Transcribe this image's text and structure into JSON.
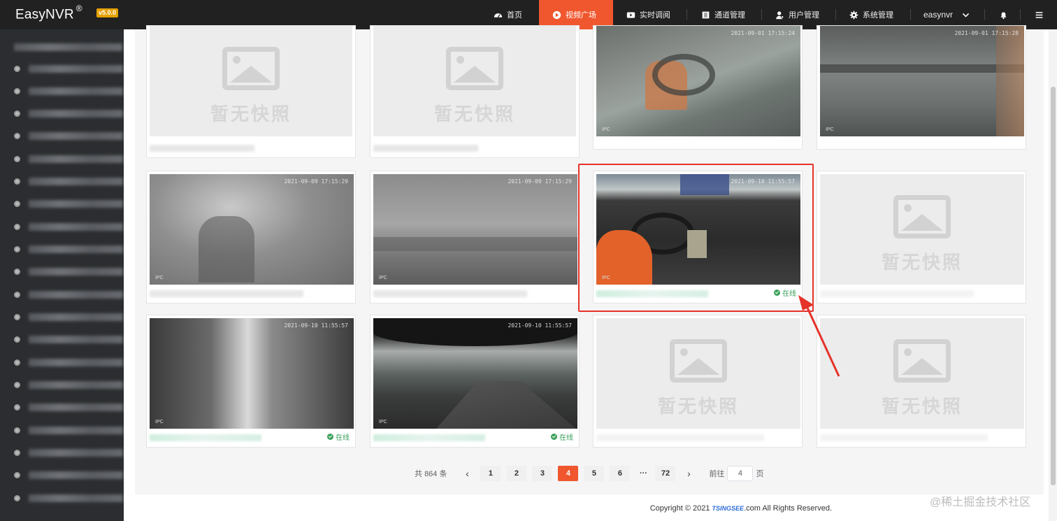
{
  "app": {
    "name": "EasyNVR",
    "trademark": "®",
    "version": "v5.0.0"
  },
  "nav": {
    "home": "首页",
    "plaza": "视频广场",
    "live": "实时调阅",
    "channel": "通道管理",
    "user": "用户管理",
    "system": "系统管理",
    "account": "easynvr"
  },
  "grid": {
    "placeholder_text": "暂无快照",
    "online_label": "在线",
    "ipc_label": "IPC",
    "timestamps": {
      "r1c3": "2021-09-01 17:15:24",
      "r1c4": "2021-09-01 17:15:28",
      "r2c1": "2021-09-09 17:15:29",
      "r2c2": "2021-09-09 17:15:29",
      "r2c3": "2021-09-10 11:55:57",
      "r3c1": "2021-09-10 11:55:57",
      "r3c2": "2021-09-10 11:55:57"
    }
  },
  "pager": {
    "total_prefix": "共",
    "total": "864",
    "total_suffix": "条",
    "pages": [
      "1",
      "2",
      "3",
      "4",
      "5",
      "6"
    ],
    "current": "4",
    "ellipsis": "···",
    "last": "72",
    "goto_label": "前往",
    "goto_value": "4",
    "goto_suffix": "页"
  },
  "footer": {
    "prefix": "Copyright © 2021",
    "brand": "TSINGSEE",
    "suffix": ".com All Rights Reserved."
  },
  "watermark": "@稀土掘金技术社区",
  "colors": {
    "accent": "#f0572e",
    "online": "#3aa05a",
    "highlight": "#e5332a",
    "topbar": "#212121",
    "sidebar": "#2b2d30"
  }
}
